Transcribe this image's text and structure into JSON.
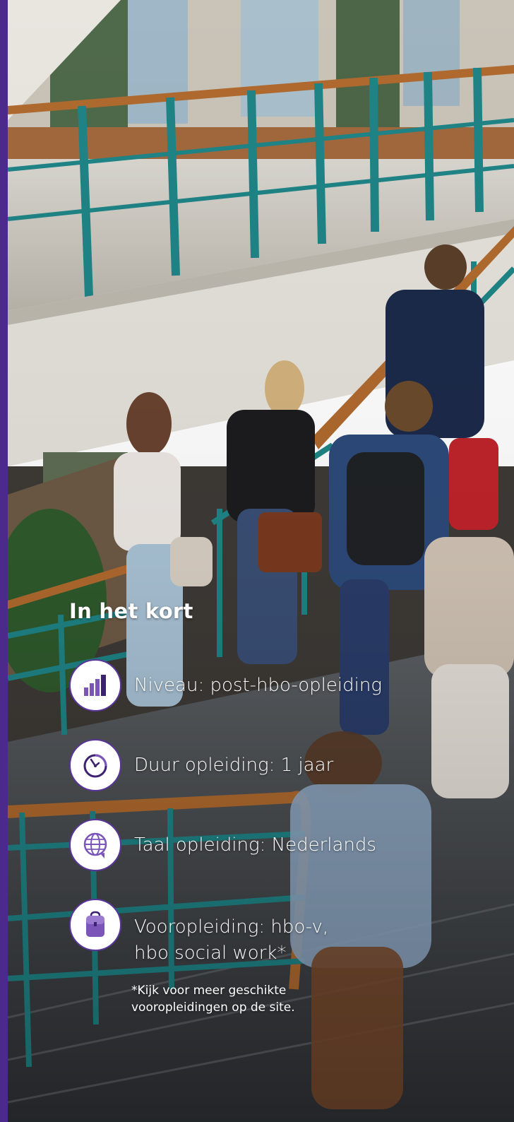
{
  "section": {
    "title": "In het kort"
  },
  "items": [
    {
      "icon": "level-bars-icon",
      "text": "Niveau: post-hbo-opleiding"
    },
    {
      "icon": "clock-icon",
      "text": "Duur opleiding: 1 jaar"
    },
    {
      "icon": "globe-speech-icon",
      "text": "Taal opleiding: Nederlands"
    },
    {
      "icon": "backpack-icon",
      "line1": "Vooropleiding: hbo-v,",
      "line2": "hbo social work*"
    }
  ],
  "footnote": {
    "line1": "*Kijk voor meer geschikte",
    "line2": "vooropleidingen op de site."
  },
  "colors": {
    "brand_purple": "#4b2a8c",
    "icon_purple": "#7b56b8",
    "railing_teal": "#1f8486",
    "railing_wood": "#b06a2e"
  }
}
